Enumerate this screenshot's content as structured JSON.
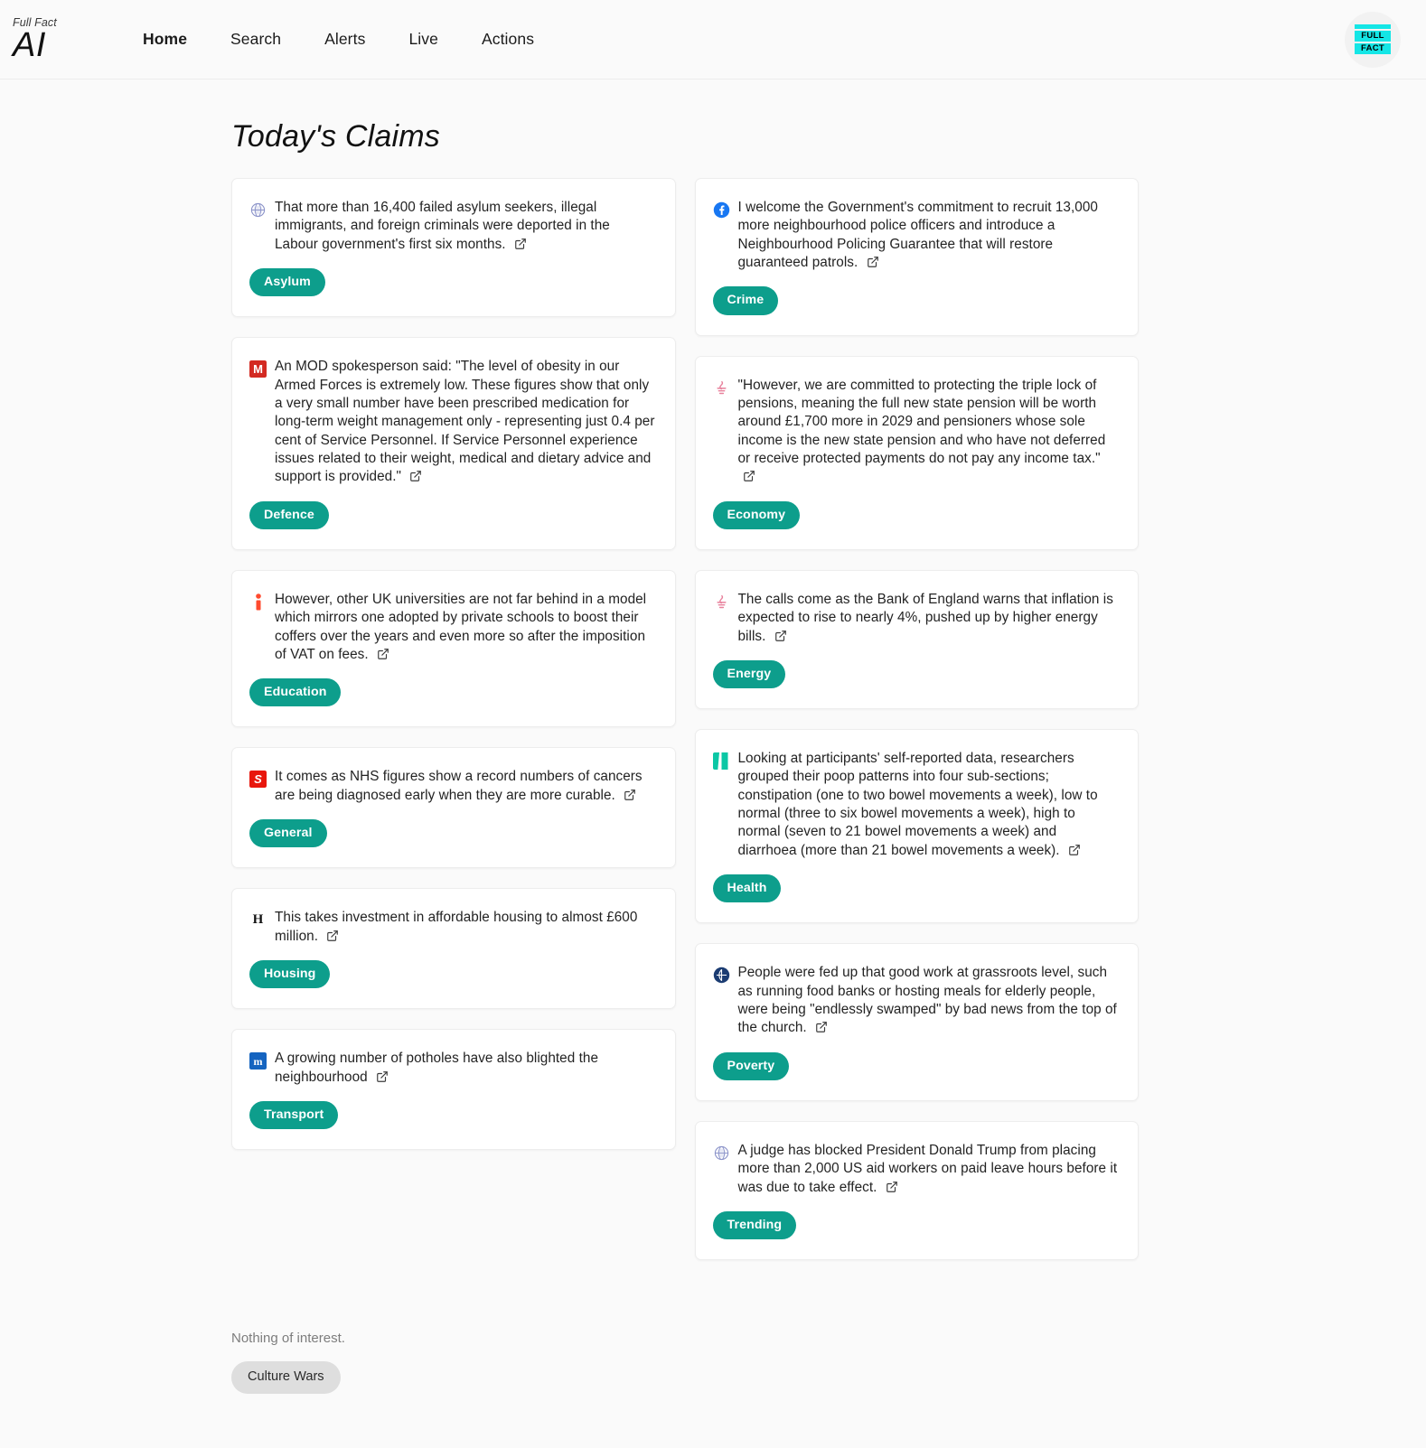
{
  "brand": {
    "sup": "Full Fact",
    "name": "AI",
    "logo_line1": "FULL",
    "logo_line2": "FACT",
    "logo_color": "#14e6e6"
  },
  "nav": {
    "items": [
      {
        "label": "Home",
        "active": true
      },
      {
        "label": "Search",
        "active": false
      },
      {
        "label": "Alerts",
        "active": false
      },
      {
        "label": "Live",
        "active": false
      },
      {
        "label": "Actions",
        "active": false
      }
    ]
  },
  "page": {
    "title": "Today's Claims",
    "tag_color": "#0d9e8c"
  },
  "claims": {
    "left": [
      {
        "icon": "globe-icon",
        "text": "That more than 16,400 failed asylum seekers, illegal immigrants, and foreign criminals were deported in the Labour government's first six months.",
        "tag": "Asylum"
      },
      {
        "icon": "mod-m-icon",
        "text": "An MOD spokesperson said: \"The level of obesity in our Armed Forces is extremely low. These figures show that only a very small number have been prescribed medication for long-term weight management only - representing just 0.4 per cent of Service Personnel. If Service Personnel experience issues related to their weight, medical and dietary advice and support is provided.\"",
        "tag": "Defence"
      },
      {
        "icon": "independent-i-icon",
        "text": "However, other UK universities are not far behind in a model which mirrors one adopted by private schools to boost their coffers over the years and even more so after the imposition of VAT on fees.",
        "tag": "Education"
      },
      {
        "icon": "sun-s-icon",
        "text": "It comes as NHS figures show a record numbers of cancers are being diagnosed early when they are more curable.",
        "tag": "General"
      },
      {
        "icon": "herald-h-icon",
        "text": "This takes investment in affordable housing to almost £600 million.",
        "tag": "Housing"
      },
      {
        "icon": "men-m-icon",
        "text": "A growing number of potholes have also blighted the neighbourhood",
        "tag": "Transport"
      }
    ],
    "right": [
      {
        "icon": "facebook-icon",
        "text": "I welcome the Government's commitment to recruit 13,000 more neighbourhood police officers and introduce a Neighbourhood Policing Guarantee that will restore guaranteed patrols.",
        "tag": "Crime"
      },
      {
        "icon": "pink-logo-icon",
        "text": "\"However, we are committed to protecting the triple lock of pensions, meaning the full new state pension will be worth around £1,700 more in 2029 and pensioners whose sole income is the new state pension and who have not deferred or receive protected payments do not pay any income tax.\"",
        "tag": "Economy"
      },
      {
        "icon": "pink-logo-icon",
        "text": "The calls come as the Bank of England warns that inflation is expected to rise to nearly 4%, pushed up by higher energy bills.",
        "tag": "Energy"
      },
      {
        "icon": "teal-bars-icon",
        "text": "Looking at participants' self-reported data, researchers grouped their poop patterns into four sub-sections; constipation (one to two bowel movements a week), low to normal (three to six bowel movements a week), high to normal (seven to 21 bowel movements a week) and diarrhoea (more than 21 bowel movements a week).",
        "tag": "Health"
      },
      {
        "icon": "blue-circle-icon",
        "text": "People were fed up that good work at grassroots level, such as running food banks or hosting meals for elderly people, were being \"endlessly swamped\" by bad news from the top of the church.",
        "tag": "Poverty"
      },
      {
        "icon": "globe-icon",
        "text": "A judge has blocked President Donald Trump from placing more than 2,000 US aid workers on paid leave hours before it was due to take effect.",
        "tag": "Trending"
      }
    ]
  },
  "footer": {
    "empty_text": "Nothing of interest.",
    "tag": "Culture Wars"
  }
}
